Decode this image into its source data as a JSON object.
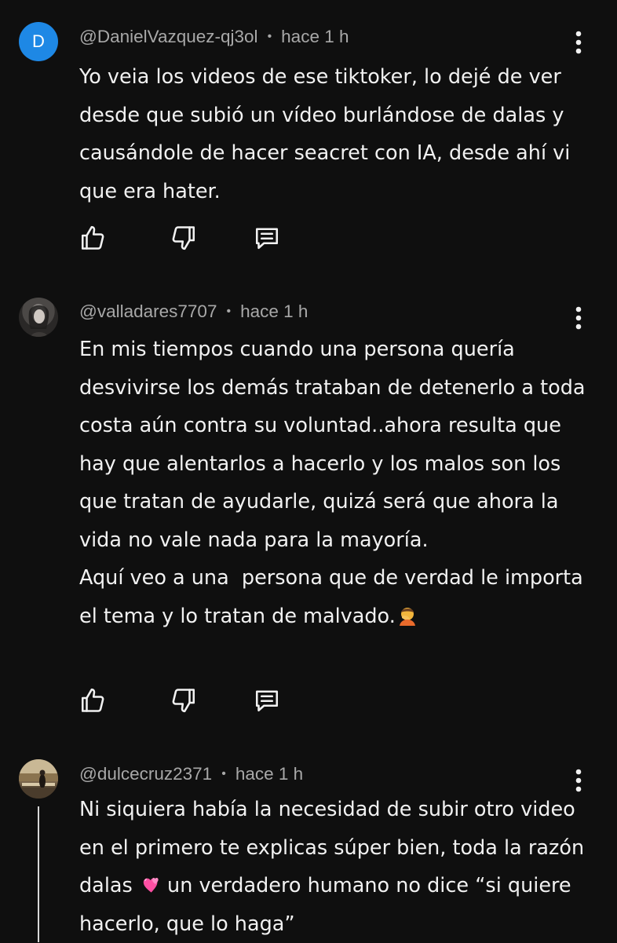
{
  "comments": [
    {
      "avatar_letter": "D",
      "avatar_color": "#1e88e5",
      "username": "@DanielVazquez-qj3ol",
      "separator": "•",
      "time": "hace 1 h",
      "text": "Yo veia los videos de ese tiktoker, lo dejé de ver desde que subió un vídeo burlándose de dalas y causándole de hacer seacret con IA, desde ahí vi que era hater.",
      "icons": [
        "like-icon",
        "dislike-icon",
        "reply-icon",
        "more-vert-icon"
      ]
    },
    {
      "username": "@valladares7707",
      "separator": "•",
      "time": "hace 1 h",
      "text": "En mis tiempos cuando una persona quería desvivirse los demás trataban de detenerlo a toda costa aún contra su voluntad..ahora resulta que hay que alentarlos a hacerlo y los malos son los que tratan de ayudarle, quizá será que ahora la vida no vale nada para la mayoría.\nAquí veo a una  persona que de verdad le importa el tema y lo tratan de malvado.",
      "emoji": "person-facepalming-emoji",
      "icons": [
        "like-icon",
        "dislike-icon",
        "reply-icon",
        "more-vert-icon"
      ]
    },
    {
      "username": "@dulcecruz2371",
      "separator": "•",
      "time": "hace 1 h",
      "text_before_emoji": "Ni siquiera había la necesidad de subir otro video en el primero te explicas súper bien, toda la razón dalas ",
      "emoji": "two-hearts-emoji",
      "text_after_emoji": " un verdadero humano no dice “si quiere hacerlo, que lo haga”",
      "icons": [
        "more-vert-icon"
      ]
    }
  ],
  "theme": {
    "background": "#0f0f0f",
    "text": "#f1f1f1",
    "meta": "#a8a8a8"
  }
}
